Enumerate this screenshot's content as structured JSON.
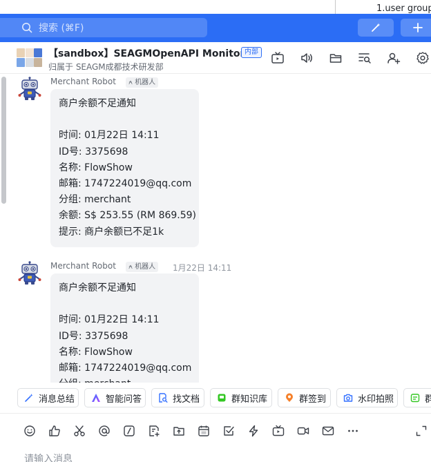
{
  "behind_window": {
    "text": "1.user group"
  },
  "search": {
    "placeholder": "搜索 (⌘F)"
  },
  "chat": {
    "title": "【sandbox】SEAGMOpenAPI Monitor...",
    "badge": "内部",
    "subtitle": "归属于 SEAGM成都技术研发部"
  },
  "messages": [
    {
      "sender": "Merchant Robot",
      "bot_tag": "机器人",
      "time": "",
      "lines": [
        "商户余额不足通知",
        "",
        "时间: 01月22日 14:11",
        "ID号: 3375698",
        "名称: FlowShow",
        "邮箱: 1747224019@qq.com",
        "分组: merchant",
        "余额: S$ 253.55 (RM 869.59)",
        "提示: 商户余额已不足1k"
      ]
    },
    {
      "sender": "Merchant Robot",
      "bot_tag": "机器人",
      "time": "1月22日 14:11",
      "lines": [
        "商户余额不足通知",
        "",
        "时间: 01月22日 14:11",
        "ID号: 3375698",
        "名称: FlowShow",
        "邮箱: 1747224019@qq.com",
        "分组: merchant"
      ]
    }
  ],
  "quick_actions": [
    {
      "label": "消息总结",
      "icon": "sparkle-icon",
      "color": "#3370ff"
    },
    {
      "label": "智能问答",
      "icon": "ai-a-icon",
      "color": "#3370ff"
    },
    {
      "label": "找文档",
      "icon": "doc-search-icon",
      "color": "#3370ff"
    },
    {
      "label": "群知识库",
      "icon": "knowledge-base-icon",
      "color": "#34c724"
    },
    {
      "label": "群签到",
      "icon": "checkin-pin-icon",
      "color": "#f5802a"
    },
    {
      "label": "水印拍照",
      "icon": "camera-icon",
      "color": "#3370ff"
    },
    {
      "label": "群",
      "icon": "calendar-icon",
      "color": "#34c724"
    }
  ],
  "composer": {
    "placeholder": "请输入消息"
  },
  "colors": {
    "brand": "#2b6df5",
    "bubble": "#f2f3f5"
  }
}
